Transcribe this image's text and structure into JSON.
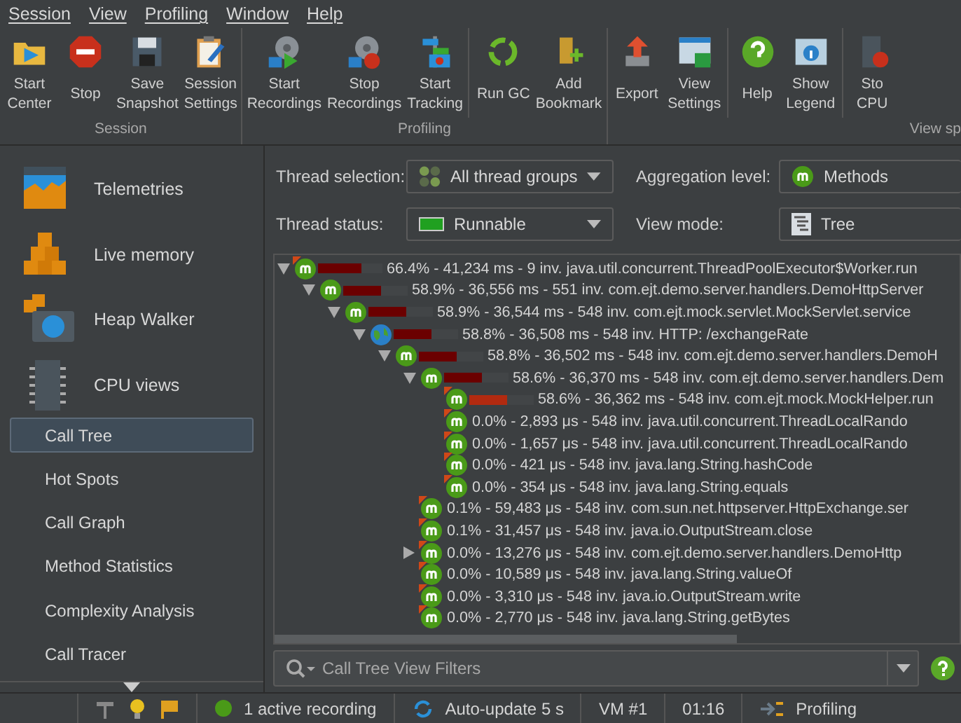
{
  "menu": [
    "Session",
    "View",
    "Profiling",
    "Window",
    "Help"
  ],
  "toolbar": [
    {
      "label": "Session",
      "buttons": [
        {
          "label": "Start\nCenter",
          "kind": "folder"
        },
        {
          "label": "Stop",
          "kind": "stop"
        },
        {
          "label": "Save\nSnapshot",
          "kind": "floppy"
        },
        {
          "label": "Session\nSettings",
          "kind": "clipboard"
        }
      ]
    },
    {
      "label": "Profiling",
      "buttons": [
        {
          "label": "Start\nRecordings",
          "kind": "reel-play"
        },
        {
          "label": "Stop\nRecordings",
          "kind": "reel-stop"
        },
        {
          "label": "Start\nTracking",
          "kind": "tracking"
        },
        {
          "label": "Run GC",
          "kind": "recycle",
          "separator": true
        },
        {
          "label": "Add\nBookmark",
          "kind": "bookmark"
        }
      ]
    },
    {
      "label": "View sp",
      "buttons": [
        {
          "label": "Export",
          "kind": "export"
        },
        {
          "label": "View\nSettings",
          "kind": "window"
        },
        {
          "label": "Help",
          "kind": "help",
          "separator": true
        },
        {
          "label": "Show\nLegend",
          "kind": "info"
        },
        {
          "label": "Sto\nCPU",
          "kind": "cpu",
          "separator": true
        }
      ]
    }
  ],
  "sidebar": {
    "sections": [
      {
        "label": "Telemetries",
        "kind": "telemetry"
      },
      {
        "label": "Live memory",
        "kind": "memory"
      },
      {
        "label": "Heap Walker",
        "kind": "camera"
      },
      {
        "label": "CPU views",
        "kind": "chip"
      }
    ],
    "items": [
      {
        "label": "Call Tree",
        "selected": true
      },
      {
        "label": "Hot Spots",
        "selected": false
      },
      {
        "label": "Call Graph",
        "selected": false
      },
      {
        "label": "Method Statistics",
        "selected": false
      },
      {
        "label": "Complexity Analysis",
        "selected": false
      },
      {
        "label": "Call Tracer",
        "selected": false
      }
    ]
  },
  "controls": [
    {
      "label": "Thread selection:",
      "value": "All thread groups",
      "kind": "groups",
      "dropdown": true
    },
    {
      "label": "Aggregation level:",
      "value": "Methods",
      "kind": "method",
      "dropdown": false
    },
    {
      "label": "Thread status:",
      "value": "Runnable",
      "kind": "status",
      "dropdown": true
    },
    {
      "label": "View mode:",
      "value": "Tree",
      "kind": "tree",
      "dropdown": false
    }
  ],
  "tree": [
    {
      "text": "66.4% - 41,234 ms - 9 inv. java.util.concurrent.ThreadPoolExecutor$Worker.run",
      "kind": "method",
      "marked": true,
      "level": 0.664,
      "color": "#6b0000",
      "expanded": true,
      "children": [
        {
          "text": "58.9% - 36,556 ms - 551 inv. com.ejt.demo.server.handlers.DemoHttpServer",
          "kind": "method",
          "marked": false,
          "level": 0.589,
          "color": "#6b0000",
          "expanded": true,
          "children": [
            {
              "text": "58.9% - 36,544 ms - 548 inv. com.ejt.mock.servlet.MockServlet.service",
              "kind": "method",
              "marked": false,
              "level": 0.589,
              "color": "#6b0000",
              "expanded": true,
              "children": [
                {
                  "text": "58.8% - 36,508 ms - 548 inv. HTTP: /exchangeRate",
                  "kind": "http",
                  "marked": false,
                  "level": 0.588,
                  "color": "#6b0000",
                  "expanded": true,
                  "children": [
                    {
                      "text": "58.8% - 36,502 ms - 548 inv. com.ejt.demo.server.handlers.DemoH",
                      "kind": "method",
                      "marked": false,
                      "level": 0.588,
                      "color": "#6b0000",
                      "expanded": true,
                      "children": [
                        {
                          "text": "58.6% - 36,370 ms - 548 inv. com.ejt.demo.server.handlers.Dem",
                          "kind": "method",
                          "marked": false,
                          "level": 0.586,
                          "color": "#6b0000",
                          "expanded": true,
                          "children": [
                            {
                              "text": "58.6% - 36,362 ms - 548 inv. com.ejt.mock.MockHelper.run",
                              "kind": "method",
                              "marked": true,
                              "level": 0.586,
                              "color": "#b22a10"
                            },
                            {
                              "text": "0.0% - 2,893 μs - 548 inv. java.util.concurrent.ThreadLocalRando",
                              "kind": "method",
                              "marked": true
                            },
                            {
                              "text": "0.0% - 1,657 μs - 548 inv. java.util.concurrent.ThreadLocalRando",
                              "kind": "method",
                              "marked": true
                            },
                            {
                              "text": "0.0% - 421 μs - 548 inv. java.lang.String.hashCode",
                              "kind": "method",
                              "marked": true
                            },
                            {
                              "text": "0.0% - 354 μs - 548 inv. java.lang.String.equals",
                              "kind": "method",
                              "marked": true
                            }
                          ]
                        },
                        {
                          "text": "0.1% - 59,483 μs - 548 inv. com.sun.net.httpserver.HttpExchange.ser",
                          "kind": "method",
                          "marked": true
                        },
                        {
                          "text": "0.1% - 31,457 μs - 548 inv. java.io.OutputStream.close",
                          "kind": "method",
                          "marked": true
                        },
                        {
                          "text": "0.0% - 13,276 μs - 548 inv. com.ejt.demo.server.handlers.DemoHttp",
                          "kind": "method",
                          "marked": true,
                          "expanded": false
                        },
                        {
                          "text": "0.0% - 10,589 μs - 548 inv. java.lang.String.valueOf",
                          "kind": "method",
                          "marked": true
                        },
                        {
                          "text": "0.0% - 3,310 μs - 548 inv. java.io.OutputStream.write",
                          "kind": "method",
                          "marked": true
                        },
                        {
                          "text": "0.0% - 2,770 μs - 548 inv. java.lang.String.getBytes",
                          "kind": "method",
                          "marked": true
                        }
                      ]
                    }
                  ]
                }
              ]
            }
          ]
        }
      ]
    }
  ],
  "filter": {
    "placeholder": "Call Tree View Filters"
  },
  "status_bar": [
    {
      "text": "1 active recording",
      "kind": "dot"
    },
    {
      "text": "Auto-update 5 s",
      "kind": "sync"
    },
    {
      "text": "VM #1",
      "kind": "plain"
    },
    {
      "text": "01:16",
      "kind": "plain"
    },
    {
      "text": "Profiling",
      "kind": "profiling"
    }
  ]
}
